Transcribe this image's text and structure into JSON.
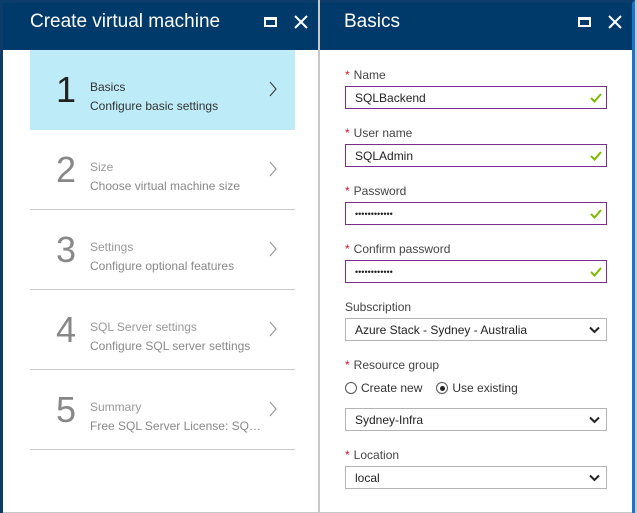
{
  "left_blade": {
    "title": "Create virtual machine",
    "steps": [
      {
        "number": "1",
        "title": "Basics",
        "subtitle": "Configure basic settings",
        "active": true
      },
      {
        "number": "2",
        "title": "Size",
        "subtitle": "Choose virtual machine size",
        "active": false
      },
      {
        "number": "3",
        "title": "Settings",
        "subtitle": "Configure optional features",
        "active": false
      },
      {
        "number": "4",
        "title": "SQL Server settings",
        "subtitle": "Configure SQL server settings",
        "active": false
      },
      {
        "number": "5",
        "title": "Summary",
        "subtitle": "Free SQL Server License: SQL S...",
        "active": false
      }
    ]
  },
  "right_blade": {
    "title": "Basics",
    "fields": {
      "name": {
        "label": "Name",
        "value": "SQLBackend",
        "required": "*"
      },
      "user_name": {
        "label": "User name",
        "value": "SQLAdmin",
        "required": "*"
      },
      "password": {
        "label": "Password",
        "value": "••••••••••••",
        "required": "*"
      },
      "confirm_password": {
        "label": "Confirm password",
        "value": "••••••••••••",
        "required": "*"
      },
      "subscription": {
        "label": "Subscription",
        "value": "Azure Stack - Sydney - Australia"
      },
      "resource_group": {
        "label": "Resource group",
        "required": "*",
        "options": [
          "Create new",
          "Use existing"
        ],
        "selected": "Use existing",
        "value": "Sydney-Infra"
      },
      "location": {
        "label": "Location",
        "value": "local",
        "required": "*"
      }
    }
  },
  "colors": {
    "header_bg": "#003a6b",
    "active_step_bg": "#bdecf8",
    "valid_border": "#7a2f8f",
    "check_green": "#7fba00",
    "required_red": "#e81123"
  }
}
